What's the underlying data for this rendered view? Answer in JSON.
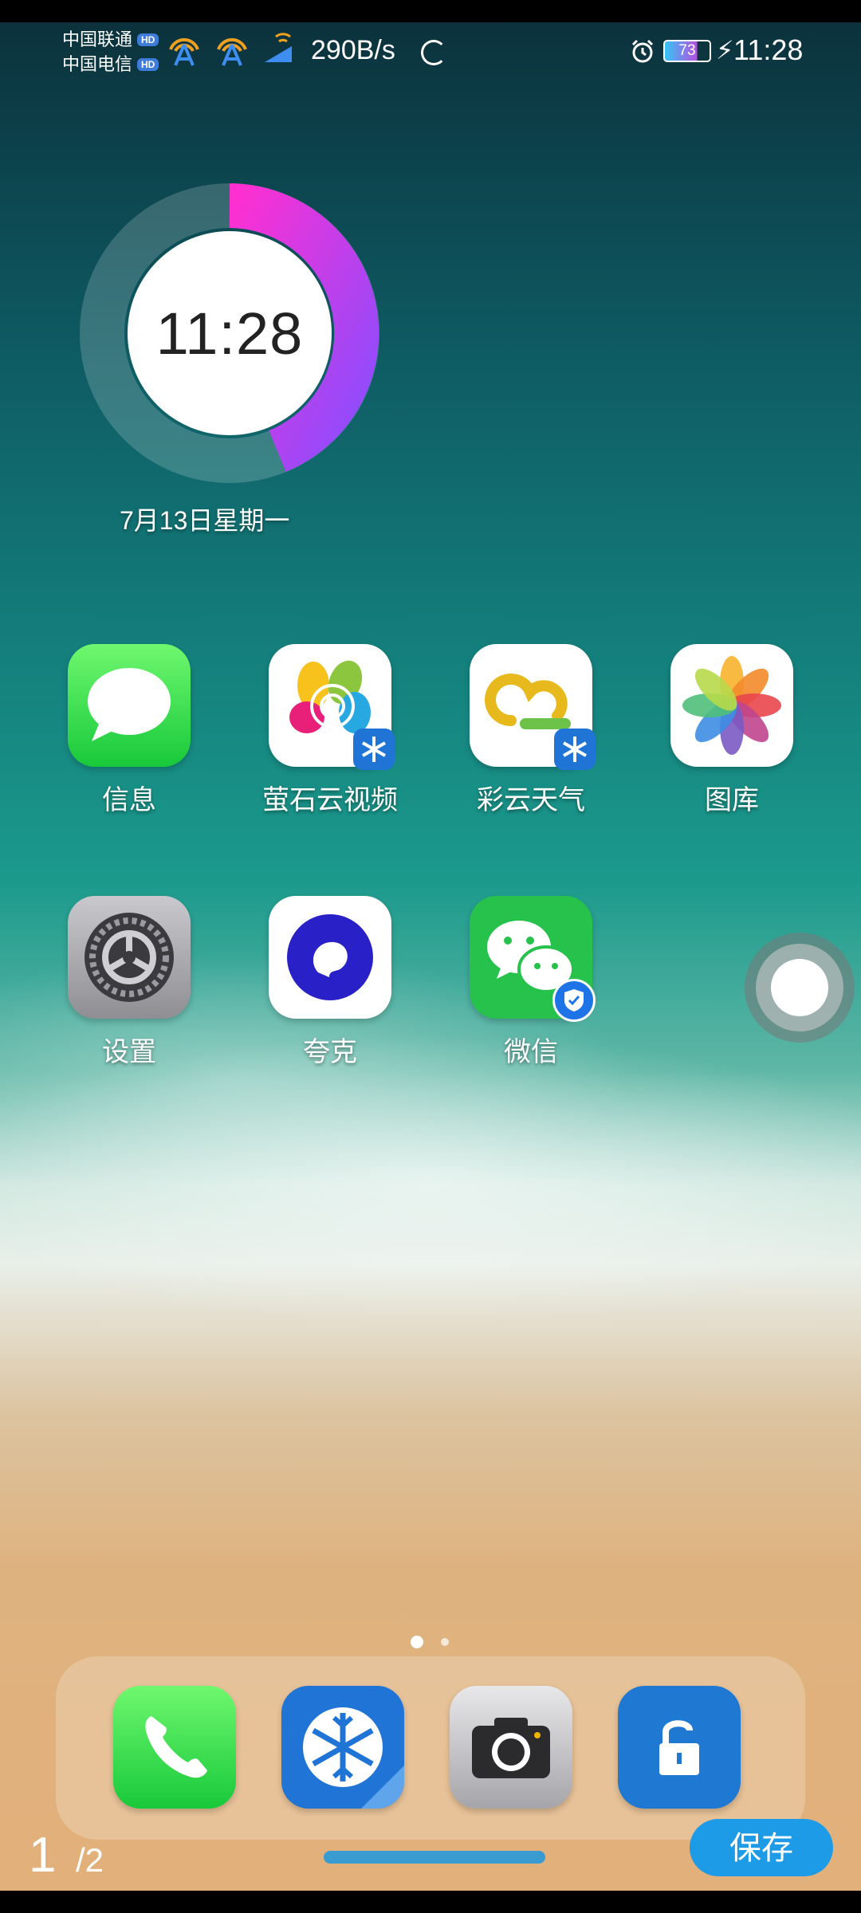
{
  "status_bar": {
    "carrier1": "中国联通",
    "carrier2": "中国电信",
    "hd": "HD",
    "net_speed": "290B/s",
    "battery": "73",
    "time": "11:28"
  },
  "clock_widget": {
    "time": "11:28",
    "date": "7月13日星期一"
  },
  "apps": [
    {
      "label": "信息",
      "icon": "messages-icon"
    },
    {
      "label": "萤石云视频",
      "icon": "ezviz-icon"
    },
    {
      "label": "彩云天气",
      "icon": "caiyun-weather-icon"
    },
    {
      "label": "图库",
      "icon": "photos-icon"
    },
    {
      "label": "设置",
      "icon": "settings-gear-icon"
    },
    {
      "label": "夸克",
      "icon": "quark-icon"
    },
    {
      "label": "微信",
      "icon": "wechat-icon"
    }
  ],
  "dock": [
    {
      "icon": "phone-icon"
    },
    {
      "icon": "snowflake-app-icon"
    },
    {
      "icon": "camera-icon"
    },
    {
      "icon": "lock-app-icon"
    }
  ],
  "page_indicator": {
    "current": 1,
    "total": 2
  },
  "bottom": {
    "page_count": "1",
    "page_total": "/2",
    "save_label": "保存"
  },
  "colors": {
    "accent": "#1e9be6",
    "ring_gradient_start": "#ff2fd1",
    "ring_gradient_end": "#8a4dff"
  }
}
